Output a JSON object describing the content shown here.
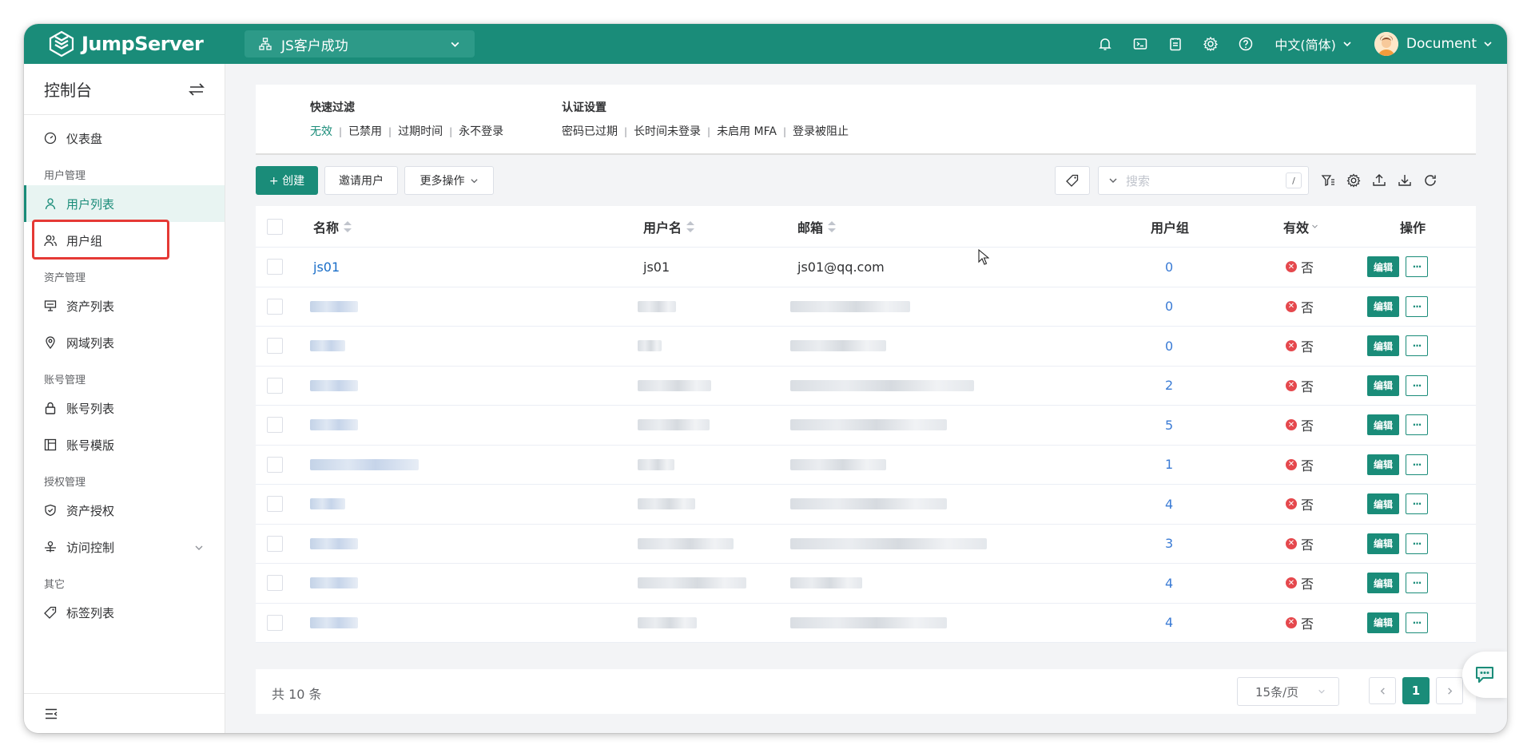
{
  "app": {
    "brand": "JumpServer",
    "org": "JS客户成功",
    "language": "中文(简体)",
    "user": "Document"
  },
  "sidebar": {
    "title": "控制台",
    "dashboard": "仪表盘",
    "groups": {
      "users": "用户管理",
      "assets": "资产管理",
      "accounts": "账号管理",
      "perms": "授权管理",
      "other": "其它"
    },
    "items": {
      "user_list": "用户列表",
      "user_group": "用户组",
      "asset_list": "资产列表",
      "zone_list": "网域列表",
      "account_list": "账号列表",
      "account_template": "账号模版",
      "asset_perm": "资产授权",
      "access_control": "访问控制",
      "label_list": "标签列表"
    }
  },
  "filters": {
    "quick": {
      "title": "快速过滤",
      "options": [
        "无效",
        "已禁用",
        "过期时间",
        "永不登录"
      ]
    },
    "auth": {
      "title": "认证设置",
      "options": [
        "密码已过期",
        "长时间未登录",
        "未启用 MFA",
        "登录被阻止"
      ]
    }
  },
  "toolbar": {
    "create": "+ 创建",
    "invite": "邀请用户",
    "more": "更多操作",
    "search_placeholder": "搜索",
    "search_shortcut": "/"
  },
  "table": {
    "columns": {
      "name": "名称",
      "username": "用户名",
      "email": "邮箱",
      "groups": "用户组",
      "valid": "有效",
      "actions": "操作"
    },
    "first_row": {
      "name": "js01",
      "username": "js01",
      "email": "js01@qq.com"
    },
    "group_counts": [
      "0",
      "0",
      "0",
      "2",
      "5",
      "1",
      "4",
      "3",
      "4",
      "4"
    ],
    "valid_text": "否",
    "edit_label": "编辑",
    "more_label": "···"
  },
  "footer": {
    "total": "共 10 条",
    "page_size": "15条/页",
    "current_page": "1"
  },
  "colors": {
    "brand": "#1a8c79",
    "link": "#1a6ec8",
    "danger": "#e5484d"
  }
}
